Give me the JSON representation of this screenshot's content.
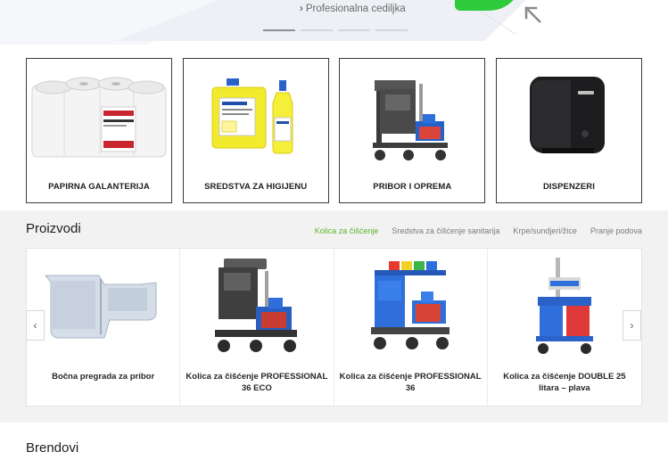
{
  "hero": {
    "caption": "Profesionalna cedilјka",
    "dots": [
      true,
      false,
      false,
      false
    ],
    "green_color": "#2ecb3c"
  },
  "categories": [
    {
      "label": "PAPIRNA GALANTERIJA",
      "icon": "paper-rolls-image"
    },
    {
      "label": "SREDSTVA ZA HIGIJENU",
      "icon": "cleaning-bottles-image"
    },
    {
      "label": "PRIBOR I OPREMA",
      "icon": "cleaning-cart-image"
    },
    {
      "label": "DISPENZERI",
      "icon": "dispenser-image"
    }
  ],
  "products": {
    "title": "Proizvodi",
    "tabs": [
      {
        "label": "Kolica za čišćenje",
        "active": true
      },
      {
        "label": "Sredstva za čišćenje sanitarija",
        "active": false
      },
      {
        "label": "Krpe/sundjeri/žice",
        "active": false
      },
      {
        "label": "Pranje podova",
        "active": false
      }
    ],
    "items": [
      {
        "name": "Bočna pregrada za pribor",
        "icon": "side-tray-image"
      },
      {
        "name": "Kolica za čišćenje PROFESSIONAL 36 ECO",
        "icon": "cart-eco-image"
      },
      {
        "name": "Kolica za čišćenje PROFESSIONAL 36",
        "icon": "cart-blue-image"
      },
      {
        "name": "Kolica za čišćenje DOUBLE 25 litara – plava",
        "icon": "mop-bucket-image"
      }
    ],
    "prev_glyph": "‹",
    "next_glyph": "›",
    "accent_color": "#5db32a"
  },
  "brands": {
    "title": "Brendovi"
  }
}
